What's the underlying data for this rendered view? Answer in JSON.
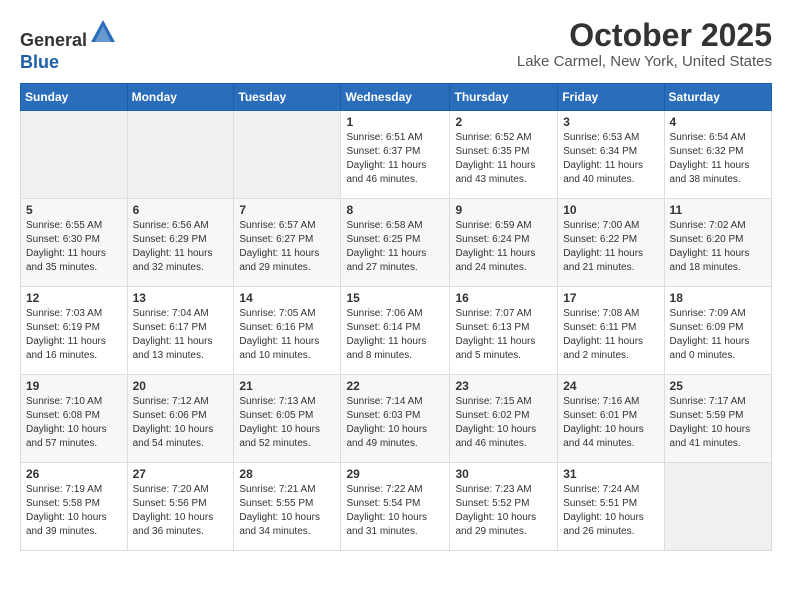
{
  "logo": {
    "general": "General",
    "blue": "Blue"
  },
  "header": {
    "month": "October 2025",
    "location": "Lake Carmel, New York, United States"
  },
  "days_of_week": [
    "Sunday",
    "Monday",
    "Tuesday",
    "Wednesday",
    "Thursday",
    "Friday",
    "Saturday"
  ],
  "weeks": [
    [
      {
        "day": "",
        "info": ""
      },
      {
        "day": "",
        "info": ""
      },
      {
        "day": "",
        "info": ""
      },
      {
        "day": "1",
        "info": "Sunrise: 6:51 AM\nSunset: 6:37 PM\nDaylight: 11 hours\nand 46 minutes."
      },
      {
        "day": "2",
        "info": "Sunrise: 6:52 AM\nSunset: 6:35 PM\nDaylight: 11 hours\nand 43 minutes."
      },
      {
        "day": "3",
        "info": "Sunrise: 6:53 AM\nSunset: 6:34 PM\nDaylight: 11 hours\nand 40 minutes."
      },
      {
        "day": "4",
        "info": "Sunrise: 6:54 AM\nSunset: 6:32 PM\nDaylight: 11 hours\nand 38 minutes."
      }
    ],
    [
      {
        "day": "5",
        "info": "Sunrise: 6:55 AM\nSunset: 6:30 PM\nDaylight: 11 hours\nand 35 minutes."
      },
      {
        "day": "6",
        "info": "Sunrise: 6:56 AM\nSunset: 6:29 PM\nDaylight: 11 hours\nand 32 minutes."
      },
      {
        "day": "7",
        "info": "Sunrise: 6:57 AM\nSunset: 6:27 PM\nDaylight: 11 hours\nand 29 minutes."
      },
      {
        "day": "8",
        "info": "Sunrise: 6:58 AM\nSunset: 6:25 PM\nDaylight: 11 hours\nand 27 minutes."
      },
      {
        "day": "9",
        "info": "Sunrise: 6:59 AM\nSunset: 6:24 PM\nDaylight: 11 hours\nand 24 minutes."
      },
      {
        "day": "10",
        "info": "Sunrise: 7:00 AM\nSunset: 6:22 PM\nDaylight: 11 hours\nand 21 minutes."
      },
      {
        "day": "11",
        "info": "Sunrise: 7:02 AM\nSunset: 6:20 PM\nDaylight: 11 hours\nand 18 minutes."
      }
    ],
    [
      {
        "day": "12",
        "info": "Sunrise: 7:03 AM\nSunset: 6:19 PM\nDaylight: 11 hours\nand 16 minutes."
      },
      {
        "day": "13",
        "info": "Sunrise: 7:04 AM\nSunset: 6:17 PM\nDaylight: 11 hours\nand 13 minutes."
      },
      {
        "day": "14",
        "info": "Sunrise: 7:05 AM\nSunset: 6:16 PM\nDaylight: 11 hours\nand 10 minutes."
      },
      {
        "day": "15",
        "info": "Sunrise: 7:06 AM\nSunset: 6:14 PM\nDaylight: 11 hours\nand 8 minutes."
      },
      {
        "day": "16",
        "info": "Sunrise: 7:07 AM\nSunset: 6:13 PM\nDaylight: 11 hours\nand 5 minutes."
      },
      {
        "day": "17",
        "info": "Sunrise: 7:08 AM\nSunset: 6:11 PM\nDaylight: 11 hours\nand 2 minutes."
      },
      {
        "day": "18",
        "info": "Sunrise: 7:09 AM\nSunset: 6:09 PM\nDaylight: 11 hours\nand 0 minutes."
      }
    ],
    [
      {
        "day": "19",
        "info": "Sunrise: 7:10 AM\nSunset: 6:08 PM\nDaylight: 10 hours\nand 57 minutes."
      },
      {
        "day": "20",
        "info": "Sunrise: 7:12 AM\nSunset: 6:06 PM\nDaylight: 10 hours\nand 54 minutes."
      },
      {
        "day": "21",
        "info": "Sunrise: 7:13 AM\nSunset: 6:05 PM\nDaylight: 10 hours\nand 52 minutes."
      },
      {
        "day": "22",
        "info": "Sunrise: 7:14 AM\nSunset: 6:03 PM\nDaylight: 10 hours\nand 49 minutes."
      },
      {
        "day": "23",
        "info": "Sunrise: 7:15 AM\nSunset: 6:02 PM\nDaylight: 10 hours\nand 46 minutes."
      },
      {
        "day": "24",
        "info": "Sunrise: 7:16 AM\nSunset: 6:01 PM\nDaylight: 10 hours\nand 44 minutes."
      },
      {
        "day": "25",
        "info": "Sunrise: 7:17 AM\nSunset: 5:59 PM\nDaylight: 10 hours\nand 41 minutes."
      }
    ],
    [
      {
        "day": "26",
        "info": "Sunrise: 7:19 AM\nSunset: 5:58 PM\nDaylight: 10 hours\nand 39 minutes."
      },
      {
        "day": "27",
        "info": "Sunrise: 7:20 AM\nSunset: 5:56 PM\nDaylight: 10 hours\nand 36 minutes."
      },
      {
        "day": "28",
        "info": "Sunrise: 7:21 AM\nSunset: 5:55 PM\nDaylight: 10 hours\nand 34 minutes."
      },
      {
        "day": "29",
        "info": "Sunrise: 7:22 AM\nSunset: 5:54 PM\nDaylight: 10 hours\nand 31 minutes."
      },
      {
        "day": "30",
        "info": "Sunrise: 7:23 AM\nSunset: 5:52 PM\nDaylight: 10 hours\nand 29 minutes."
      },
      {
        "day": "31",
        "info": "Sunrise: 7:24 AM\nSunset: 5:51 PM\nDaylight: 10 hours\nand 26 minutes."
      },
      {
        "day": "",
        "info": ""
      }
    ]
  ]
}
